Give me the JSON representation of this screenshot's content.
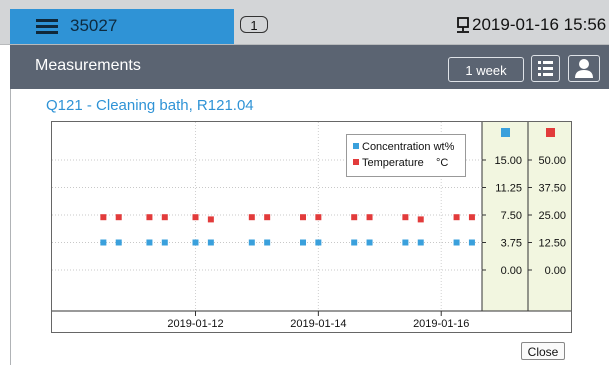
{
  "topbar": {
    "menu_icon": "hamburger-icon",
    "device_id": "35027",
    "badge": "1",
    "network_icon": "network-icon",
    "datetime": "2019-01-16 15:56"
  },
  "header": {
    "title": "Measurements",
    "range_button": "1 week",
    "list_icon": "list-icon",
    "user_icon": "user-icon"
  },
  "chart_title": "Q121 - Cleaning bath, R121.04",
  "colors": {
    "accent": "#2f93d6",
    "concentration": "#3aa0dc",
    "temperature": "#e23b3b",
    "axis_panel": "#f2f6e0"
  },
  "close_label": "Close",
  "chart_data": {
    "type": "scatter",
    "x_ticks": [
      "2019-01-12",
      "2019-01-14",
      "2019-01-16"
    ],
    "xlim": [
      "2019-01-09 15:56",
      "2019-01-16 15:56"
    ],
    "legend_position": "top-right",
    "series": [
      {
        "name": "Concentration",
        "unit": "wt%",
        "color": "#3aa0dc",
        "axis_ticks": [
          "15.00",
          "11.25",
          "7.50",
          "3.75",
          "0.00"
        ],
        "ylim": [
          0,
          15
        ],
        "x": [
          "2019-01-10 12:00",
          "2019-01-10 18:00",
          "2019-01-11 06:00",
          "2019-01-11 12:00",
          "2019-01-12 00:00",
          "2019-01-12 06:00",
          "2019-01-12 22:00",
          "2019-01-13 04:00",
          "2019-01-13 18:00",
          "2019-01-14 00:00",
          "2019-01-14 14:00",
          "2019-01-14 20:00",
          "2019-01-15 10:00",
          "2019-01-15 16:00",
          "2019-01-16 06:00",
          "2019-01-16 12:00"
        ],
        "values": [
          3.75,
          3.75,
          3.75,
          3.75,
          3.75,
          3.75,
          3.75,
          3.75,
          3.75,
          3.75,
          3.75,
          3.75,
          3.75,
          3.75,
          3.75,
          3.75
        ]
      },
      {
        "name": "Temperature",
        "unit": "°C",
        "color": "#e23b3b",
        "axis_ticks": [
          "50.00",
          "37.50",
          "25.00",
          "12.50",
          "0.00"
        ],
        "ylim": [
          0,
          50
        ],
        "x": [
          "2019-01-10 12:00",
          "2019-01-10 18:00",
          "2019-01-11 06:00",
          "2019-01-11 12:00",
          "2019-01-12 00:00",
          "2019-01-12 06:00",
          "2019-01-12 22:00",
          "2019-01-13 04:00",
          "2019-01-13 18:00",
          "2019-01-14 00:00",
          "2019-01-14 14:00",
          "2019-01-14 20:00",
          "2019-01-15 10:00",
          "2019-01-15 16:00",
          "2019-01-16 06:00",
          "2019-01-16 12:00"
        ],
        "values": [
          24,
          24,
          24,
          24,
          24,
          23,
          24,
          24,
          24,
          24,
          24,
          24,
          24,
          23,
          24,
          24
        ]
      }
    ]
  }
}
